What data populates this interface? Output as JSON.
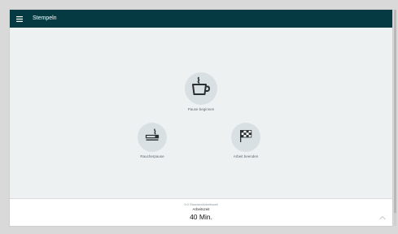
{
  "appbar": {
    "title": "Stempeln",
    "menu_icon": "menu-icon"
  },
  "actions": {
    "pause": {
      "label": "Pause beginnen",
      "icon": "coffee-cup-icon"
    },
    "smoke": {
      "label": "Raucherpause",
      "icon": "cigarette-icon"
    },
    "end": {
      "label": "Arbeit beenden",
      "icon": "checkered-flag-icon"
    }
  },
  "footer": {
    "caption": "9.0 Stunden/Arbeitszeit",
    "label": "Arbeitszeit",
    "value": "40 Min.",
    "expand_icon": "chevron-up-icon"
  },
  "colors": {
    "appbar": "#063a43",
    "background": "#eef1f2",
    "circle": "#d9e0e3",
    "icon": "#2a2f31"
  }
}
